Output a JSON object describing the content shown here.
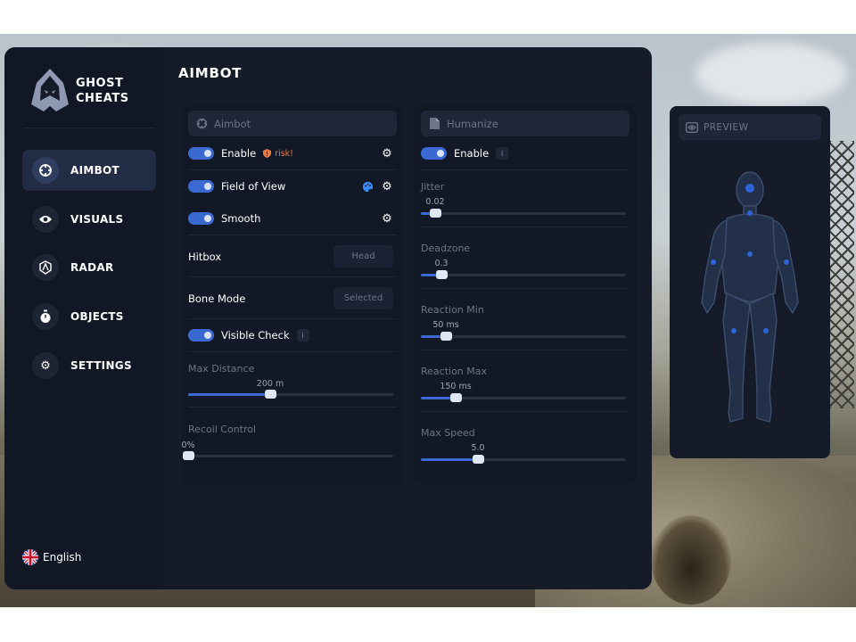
{
  "brand": {
    "line1": "GHOST",
    "line2": "CHEATS"
  },
  "nav": [
    {
      "label": "AIMBOT",
      "icon": "crosshair-icon",
      "active": true
    },
    {
      "label": "VISUALS",
      "icon": "eye-icon",
      "active": false
    },
    {
      "label": "RADAR",
      "icon": "radar-icon",
      "active": false
    },
    {
      "label": "OBJECTS",
      "icon": "stopwatch-icon",
      "active": false
    },
    {
      "label": "SETTINGS",
      "icon": "gear-icon",
      "active": false
    }
  ],
  "language": {
    "label": "English",
    "icon": "uk-flag-icon"
  },
  "page_title": "AIMBOT",
  "aimbot_panel": {
    "title": "Aimbot",
    "enable": {
      "label": "Enable",
      "on": true,
      "risk_label": "risk!"
    },
    "field_of_view": {
      "label": "Field of View",
      "on": true
    },
    "smooth": {
      "label": "Smooth",
      "on": true
    },
    "hitbox": {
      "label": "Hitbox",
      "value": "Head"
    },
    "bone_mode": {
      "label": "Bone Mode",
      "value": "Selected"
    },
    "visible_check": {
      "label": "Visible Check",
      "on": true,
      "info": "i"
    },
    "max_distance": {
      "label": "Max Distance",
      "value_text": "200 m",
      "fraction": 0.4
    },
    "recoil_control": {
      "label": "Recoil Control",
      "value_text": "0%",
      "fraction": 0.0
    }
  },
  "humanize_panel": {
    "title": "Humanize",
    "enable": {
      "label": "Enable",
      "on": true,
      "info": "i"
    },
    "jitter": {
      "label": "Jitter",
      "value_text": "0.02",
      "fraction": 0.07
    },
    "deadzone": {
      "label": "Deadzone",
      "value_text": "0.3",
      "fraction": 0.1
    },
    "reaction_min": {
      "label": "Reaction Min",
      "value_text": "50 ms",
      "fraction": 0.12
    },
    "reaction_max": {
      "label": "Reaction Max",
      "value_text": "150 ms",
      "fraction": 0.17
    },
    "max_speed": {
      "label": "Max Speed",
      "value_text": "5.0",
      "fraction": 0.28
    }
  },
  "preview": {
    "title": "PREVIEW"
  },
  "colors": {
    "accent": "#3a6ad1",
    "risk": "#e67a43",
    "panel": "#121826",
    "window": "#151b29"
  }
}
